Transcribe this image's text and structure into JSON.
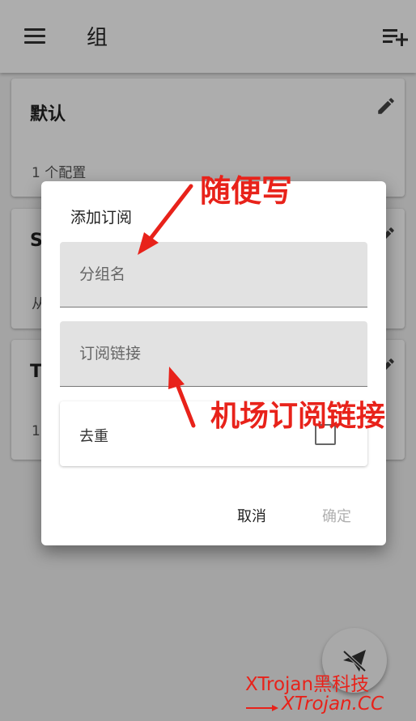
{
  "topbar": {
    "title": "组",
    "menu_icon": "hamburger-menu-icon",
    "add_icon": "playlist-add-icon"
  },
  "groups": [
    {
      "name": "默认",
      "subtitle": "1 个配置"
    },
    {
      "name": "S",
      "subtitle": "从"
    },
    {
      "name": "T",
      "subtitle": "1"
    }
  ],
  "dialog": {
    "title": "添加订阅",
    "group_name_placeholder": "分组名",
    "group_name_value": "",
    "sub_link_placeholder": "订阅链接",
    "sub_link_value": "",
    "dedupe_label": "去重",
    "dedupe_checked": false,
    "cancel_label": "取消",
    "confirm_label": "确定"
  },
  "annotations": {
    "arrow1_text": "随便写",
    "arrow2_text": "机场订阅链接"
  },
  "watermark": {
    "line1": "XTrojan黑科技",
    "line2": "XTrojan.CC"
  },
  "colors": {
    "annotation_red": "#e8221a",
    "disabled_text": "#b0b0b0",
    "field_bg": "#e2e2e2"
  }
}
